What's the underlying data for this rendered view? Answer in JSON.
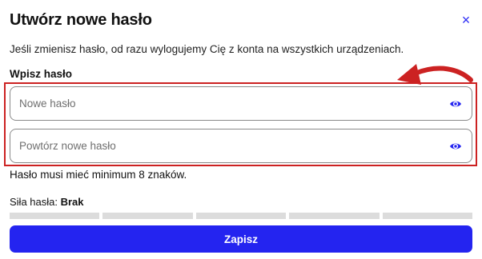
{
  "dialog": {
    "title": "Utwórz nowe hasło",
    "close_symbol": "×",
    "description": "Jeśli zmienisz hasło, od razu wylogujemy Cię z konta na wszystkich urządzeniach.",
    "section_label": "Wpisz hasło"
  },
  "fields": {
    "new_password": {
      "placeholder": "Nowe hasło",
      "value": "",
      "icon": "eye-icon"
    },
    "repeat_password": {
      "placeholder": "Powtórz nowe hasło",
      "value": "",
      "icon": "eye-icon"
    }
  },
  "hint": "Hasło musi mieć minimum 8 znaków.",
  "strength": {
    "label": "Siła hasła:",
    "value": "Brak",
    "segments_filled": 0,
    "segments_total": 5
  },
  "save_button": {
    "label": "Zapisz"
  },
  "colors": {
    "accent": "#2424f0",
    "annotation": "#cc2222",
    "strength_empty": "#dcdcdc"
  }
}
